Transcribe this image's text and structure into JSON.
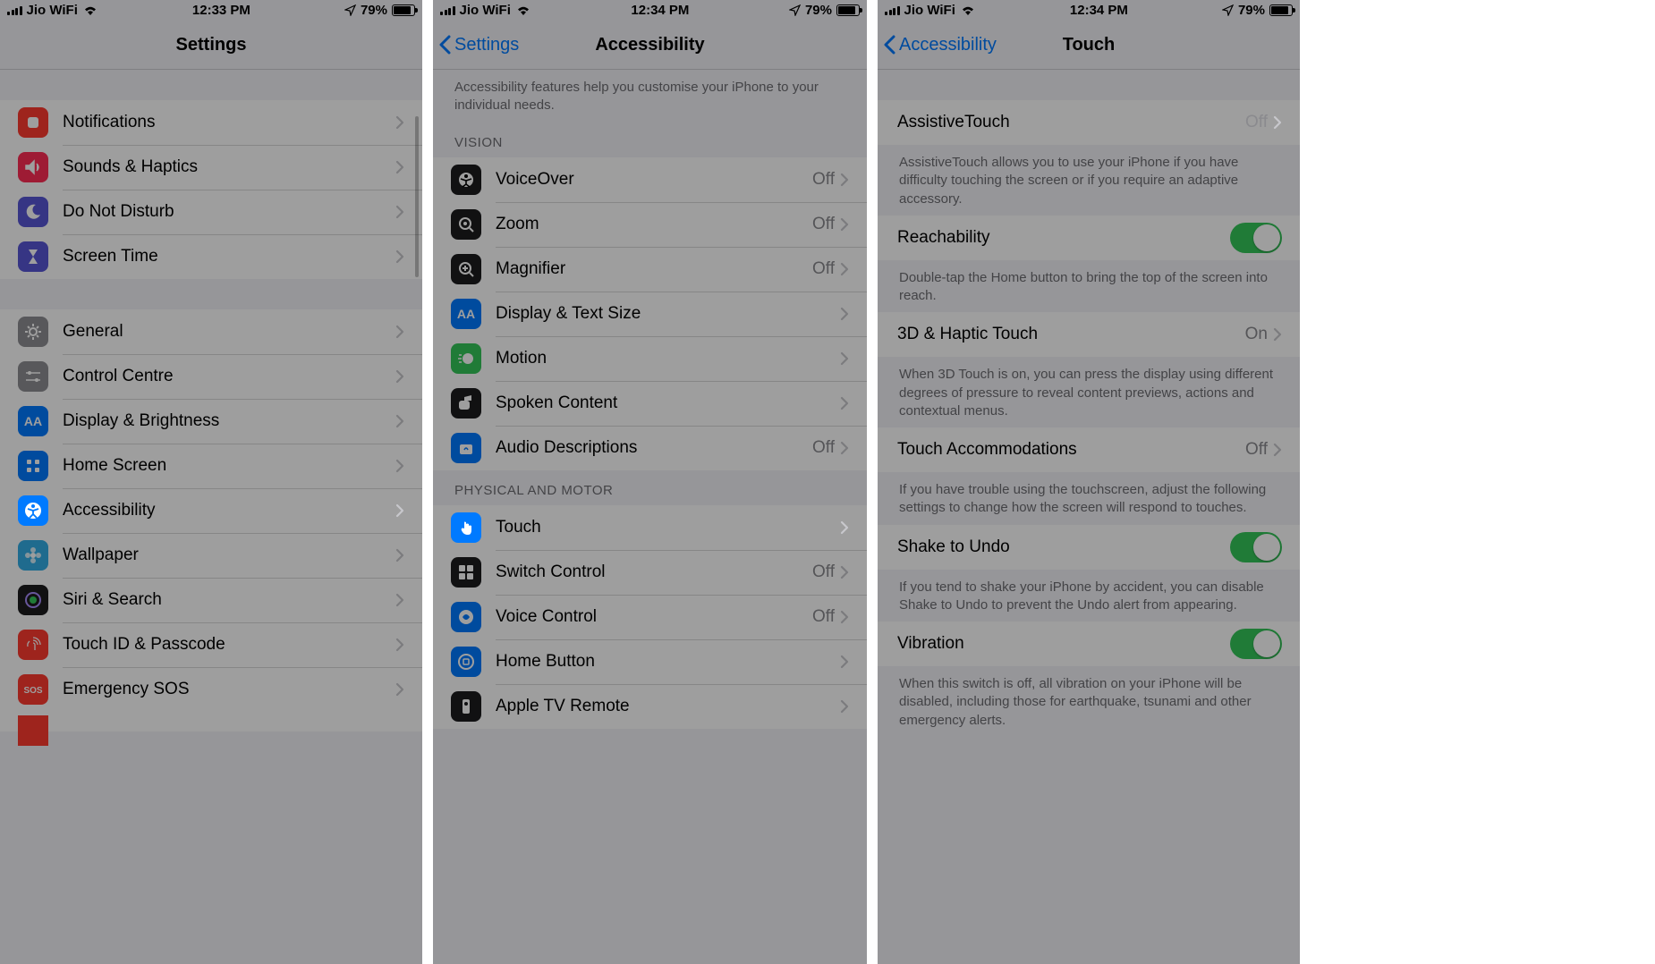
{
  "status": {
    "carrier": "Jio WiFi",
    "battery_pct": "79%"
  },
  "panel1": {
    "time": "12:33 PM",
    "title": "Settings",
    "items": [
      {
        "label": "Notifications",
        "ic": "notif",
        "bg": "ic-red"
      },
      {
        "label": "Sounds & Haptics",
        "ic": "sound",
        "bg": "ic-pink"
      },
      {
        "label": "Do Not Disturb",
        "ic": "moon",
        "bg": "ic-purple"
      },
      {
        "label": "Screen Time",
        "ic": "hourglass",
        "bg": "ic-purple"
      }
    ],
    "items2": [
      {
        "label": "General",
        "ic": "gear",
        "bg": "ic-gray"
      },
      {
        "label": "Control Centre",
        "ic": "sliders",
        "bg": "ic-gray"
      },
      {
        "label": "Display & Brightness",
        "ic": "text",
        "bg": "ic-blue"
      },
      {
        "label": "Home Screen",
        "ic": "grid",
        "bg": "ic-blue"
      },
      {
        "label": "Accessibility",
        "ic": "access",
        "bg": "ic-blue",
        "hl": true
      },
      {
        "label": "Wallpaper",
        "ic": "flower",
        "bg": "ic-teal"
      },
      {
        "label": "Siri & Search",
        "ic": "siri",
        "bg": "ic-dark"
      },
      {
        "label": "Touch ID & Passcode",
        "ic": "finger",
        "bg": "ic-red"
      },
      {
        "label": "Emergency SOS",
        "ic": "sos",
        "bg": "ic-sos"
      }
    ]
  },
  "panel2": {
    "time": "12:34 PM",
    "back": "Settings",
    "title": "Accessibility",
    "desc": "Accessibility features help you customise your iPhone to your individual needs.",
    "sec1_label": "VISION",
    "sec1": [
      {
        "label": "VoiceOver",
        "val": "Off",
        "ic": "voice",
        "bg": "ic-dark"
      },
      {
        "label": "Zoom",
        "val": "Off",
        "ic": "zoom",
        "bg": "ic-dark"
      },
      {
        "label": "Magnifier",
        "val": "Off",
        "ic": "mag",
        "bg": "ic-dark"
      },
      {
        "label": "Display & Text Size",
        "ic": "text",
        "bg": "ic-blue"
      },
      {
        "label": "Motion",
        "ic": "motion",
        "bg": "ic-green"
      },
      {
        "label": "Spoken Content",
        "ic": "speak",
        "bg": "ic-dark"
      },
      {
        "label": "Audio Descriptions",
        "val": "Off",
        "ic": "audio",
        "bg": "ic-blue"
      }
    ],
    "sec2_label": "PHYSICAL AND MOTOR",
    "sec2": [
      {
        "label": "Touch",
        "ic": "touch",
        "bg": "ic-blue",
        "hl": true
      },
      {
        "label": "Switch Control",
        "val": "Off",
        "ic": "switch",
        "bg": "ic-dark"
      },
      {
        "label": "Voice Control",
        "val": "Off",
        "ic": "vcontrol",
        "bg": "ic-blue"
      },
      {
        "label": "Home Button",
        "ic": "home",
        "bg": "ic-blue"
      },
      {
        "label": "Apple TV Remote",
        "ic": "tv",
        "bg": "ic-dark"
      }
    ]
  },
  "panel3": {
    "time": "12:34 PM",
    "back": "Accessibility",
    "title": "Touch",
    "rows": [
      {
        "label": "AssistiveTouch",
        "val": "Off",
        "hl": true,
        "chev": true
      },
      {
        "desc": "AssistiveTouch allows you to use your iPhone if you have difficulty touching the screen or if you require an adaptive accessory."
      },
      {
        "label": "Reachability",
        "toggle": true
      },
      {
        "desc": "Double-tap the Home button to bring the top of the screen into reach."
      },
      {
        "label": "3D & Haptic Touch",
        "val": "On",
        "chev": true
      },
      {
        "desc": "When 3D Touch is on, you can press the display using different degrees of pressure to reveal content previews, actions and contextual menus."
      },
      {
        "label": "Touch Accommodations",
        "val": "Off",
        "chev": true
      },
      {
        "desc": "If you have trouble using the touchscreen, adjust the following settings to change how the screen will respond to touches."
      },
      {
        "label": "Shake to Undo",
        "toggle": true
      },
      {
        "desc": "If you tend to shake your iPhone by accident, you can disable Shake to Undo to prevent the Undo alert from appearing."
      },
      {
        "label": "Vibration",
        "toggle": true
      },
      {
        "desc": "When this switch is off, all vibration on your iPhone will be disabled, including those for earthquake, tsunami and other emergency alerts."
      }
    ]
  }
}
